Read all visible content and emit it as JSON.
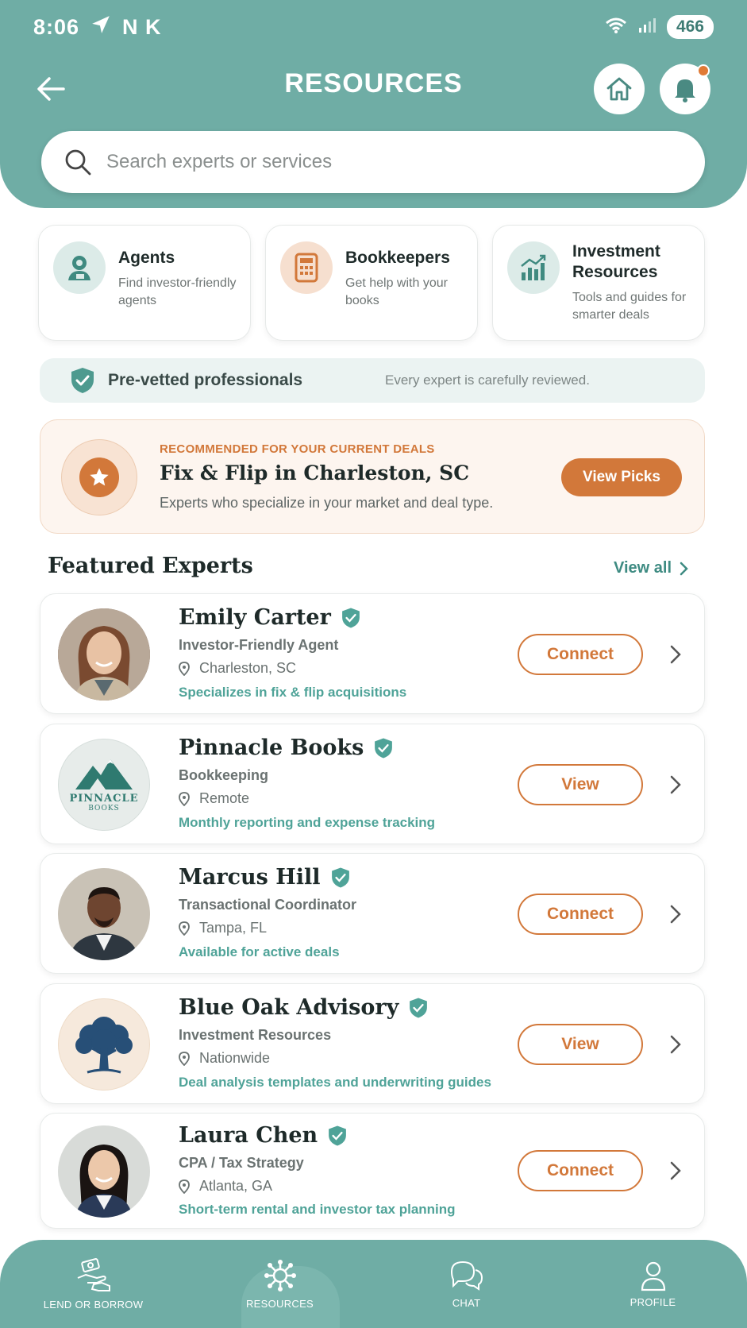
{
  "status_bar": {
    "time": "8:06",
    "letters": "N K",
    "battery": "466"
  },
  "header": {
    "title": "RESOURCES",
    "search_placeholder": "Search experts or services"
  },
  "categories": [
    {
      "title": "Agents",
      "desc": "Find investor-friendly agents",
      "icon": "agent-icon"
    },
    {
      "title": "Bookkeepers",
      "desc": "Get help with your books",
      "icon": "calculator-icon"
    },
    {
      "title": "Investment Resources",
      "desc": "Tools and guides for smarter deals",
      "icon": "chart-growth-icon"
    }
  ],
  "prevetted": {
    "label": "Pre-vetted professionals",
    "note": "Every expert is carefully reviewed."
  },
  "recommendation": {
    "eyebrow": "RECOMMENDED FOR YOUR CURRENT DEALS",
    "title": "Fix & Flip in Charleston, SC",
    "desc": "Experts who specialize in your market and deal type.",
    "button": "View Picks"
  },
  "featured": {
    "title": "Featured Experts",
    "view_all": "View all",
    "experts": [
      {
        "name": "Emily Carter",
        "role": "Investor-Friendly Agent",
        "location": "Charleston, SC",
        "note": "Specializes in fix & flip acquisitions",
        "action": "Connect"
      },
      {
        "name": "Pinnacle Books",
        "role": "Bookkeeping",
        "location": "Remote",
        "note": "Monthly reporting and expense tracking",
        "action": "View",
        "logo_text": "PINNACLE",
        "logo_sub": "BOOKS"
      },
      {
        "name": "Marcus Hill",
        "role": "Transactional Coordinator",
        "location": "Tampa, FL",
        "note": "Available for active deals",
        "action": "Connect"
      },
      {
        "name": "Blue Oak Advisory",
        "role": "Investment Resources",
        "location": "Nationwide",
        "note": "Deal analysis templates and underwriting guides",
        "action": "View"
      },
      {
        "name": "Laura Chen",
        "role": "CPA / Tax Strategy",
        "location": "Atlanta, GA",
        "note": "Short-term rental and investor tax planning",
        "action": "Connect"
      }
    ]
  },
  "bottom_nav": [
    {
      "label": "LEND OR BORROW",
      "icon": "hand-money-icon"
    },
    {
      "label": "RESOURCES",
      "icon": "network-icon",
      "active": true
    },
    {
      "label": "CHAT",
      "icon": "chat-icon"
    },
    {
      "label": "PROFILE",
      "icon": "profile-icon"
    }
  ],
  "colors": {
    "primary": "#6fada5",
    "accent": "#d2783a",
    "verified": "#4fa398"
  }
}
